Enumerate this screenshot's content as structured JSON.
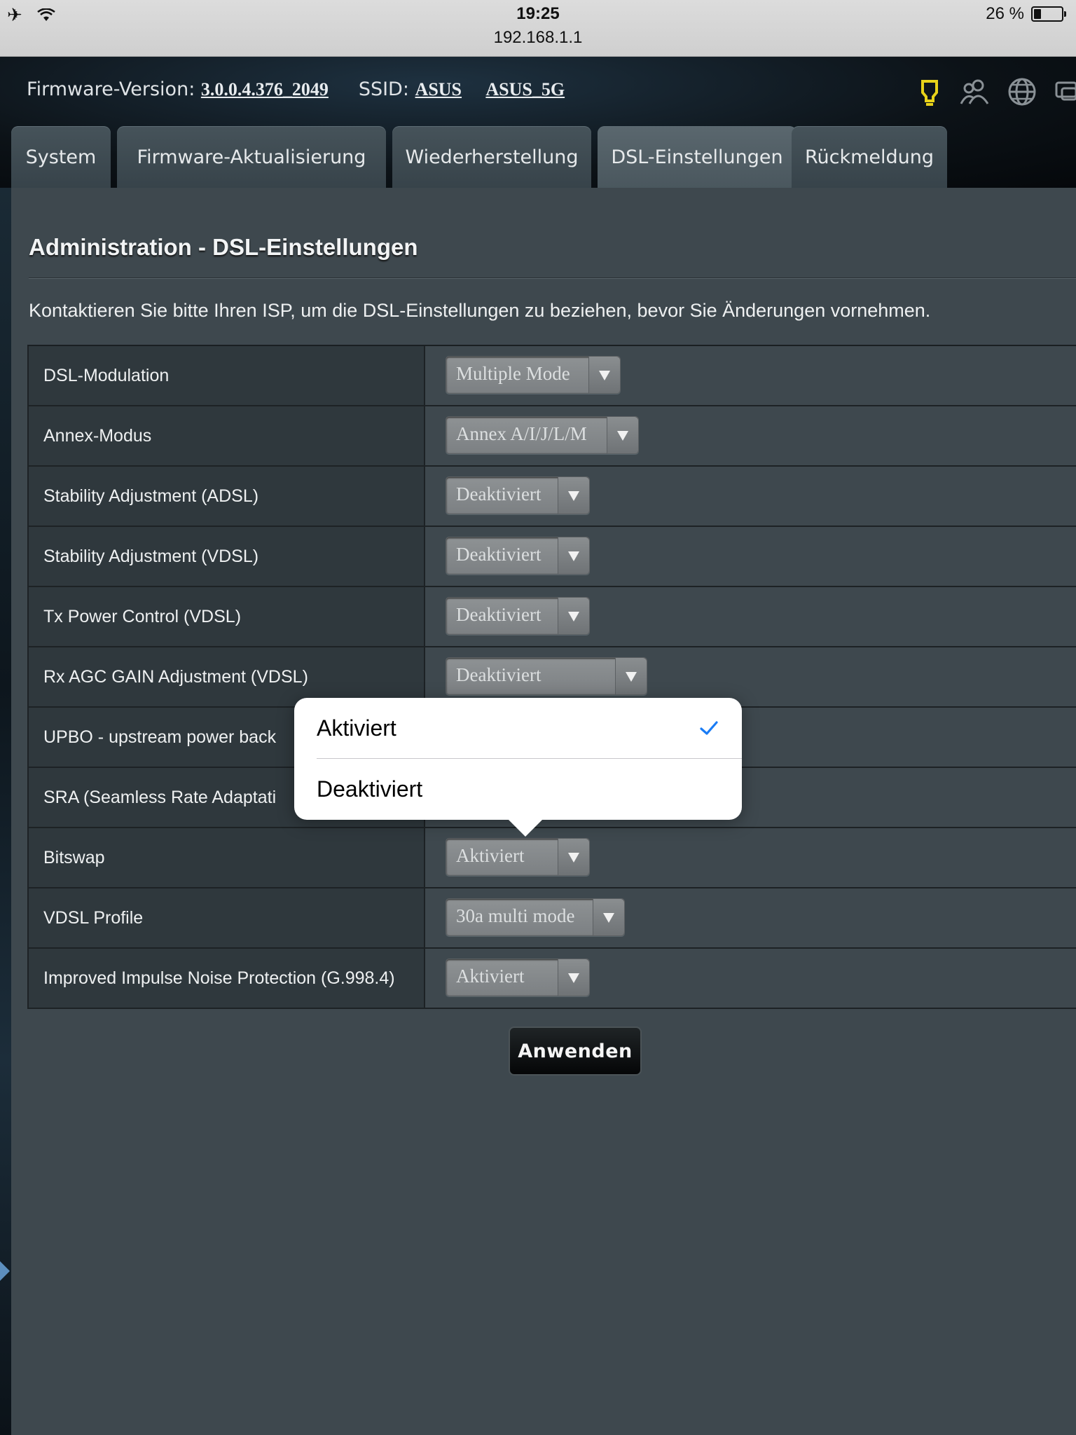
{
  "status_bar": {
    "time": "19:25",
    "url": "192.168.1.1",
    "battery": "26 %",
    "battery_level": 0.26,
    "icons": [
      "airplane-icon",
      "wifi-icon",
      "battery-icon"
    ]
  },
  "header": {
    "firmware_label": "Firmware-Version:",
    "firmware_value": "3.0.0.4.376_2049",
    "ssid_label": "SSID:",
    "ssid_values": [
      "ASUS",
      "ASUS_5G"
    ],
    "icons": [
      "usb-icon",
      "clients-icon",
      "internet-globe-icon",
      "network-map-icon"
    ],
    "accent_color": "#e8d21a"
  },
  "tabs": [
    {
      "label": "System"
    },
    {
      "label": "Firmware-Aktualisierung"
    },
    {
      "label": "Wiederherstellung"
    },
    {
      "label": "DSL-Einstellungen",
      "active": true
    },
    {
      "label": "Rückmeldung"
    }
  ],
  "page": {
    "title": "Administration - DSL-Einstellungen",
    "notice": "Kontaktieren Sie bitte Ihren ISP, um die DSL-Einstellungen zu beziehen, bevor Sie Änderungen vornehmen."
  },
  "settings": [
    {
      "label": "DSL-Modulation",
      "value": "Multiple Mode"
    },
    {
      "label": "Annex-Modus",
      "value": "Annex A/I/J/L/M"
    },
    {
      "label": "Stability Adjustment (ADSL)",
      "value": "Deaktiviert"
    },
    {
      "label": "Stability Adjustment (VDSL)",
      "value": "Deaktiviert"
    },
    {
      "label": "Tx Power Control (VDSL)",
      "value": "Deaktiviert"
    },
    {
      "label": "Rx AGC GAIN Adjustment (VDSL)",
      "value": "Deaktiviert"
    },
    {
      "label": "UPBO - upstream power back",
      "value": ""
    },
    {
      "label": "SRA (Seamless Rate Adaptati",
      "value": ""
    },
    {
      "label": "Bitswap",
      "value": "Aktiviert"
    },
    {
      "label": "VDSL Profile",
      "value": "30a multi mode"
    },
    {
      "label": "Improved Impulse Noise Protection (G.998.4)",
      "value": "Aktiviert"
    }
  ],
  "apply_button": "Anwenden",
  "popover": {
    "options": [
      {
        "label": "Aktiviert",
        "selected": true
      },
      {
        "label": "Deaktiviert",
        "selected": false
      }
    ],
    "check_color": "#1a7cf5"
  }
}
